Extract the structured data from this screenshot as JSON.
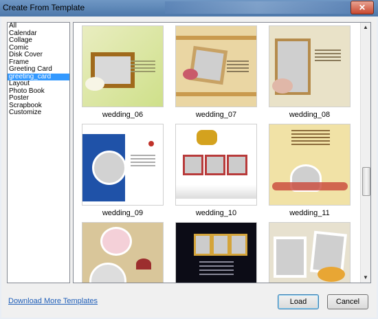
{
  "window": {
    "title": "Create From Template",
    "close_glyph": "✕"
  },
  "categories": [
    {
      "label": "All"
    },
    {
      "label": "Calendar"
    },
    {
      "label": "Collage"
    },
    {
      "label": "Comic"
    },
    {
      "label": "Disk Cover"
    },
    {
      "label": "Frame"
    },
    {
      "label": "Greeting Card"
    },
    {
      "label": "greeting_card",
      "selected": true
    },
    {
      "label": "Layout"
    },
    {
      "label": "Photo Book"
    },
    {
      "label": "Poster"
    },
    {
      "label": "Scrapbook"
    },
    {
      "label": "Customize"
    }
  ],
  "templates": [
    {
      "name": "wedding_06"
    },
    {
      "name": "wedding_07"
    },
    {
      "name": "wedding_08"
    },
    {
      "name": "wedding_09"
    },
    {
      "name": "wedding_10"
    },
    {
      "name": "wedding_11"
    },
    {
      "name": ""
    },
    {
      "name": ""
    },
    {
      "name": ""
    }
  ],
  "footer": {
    "link_label": "Download More Templates",
    "load_label": "Load",
    "cancel_label": "Cancel"
  },
  "scroll": {
    "up_glyph": "▲",
    "down_glyph": "▼"
  }
}
